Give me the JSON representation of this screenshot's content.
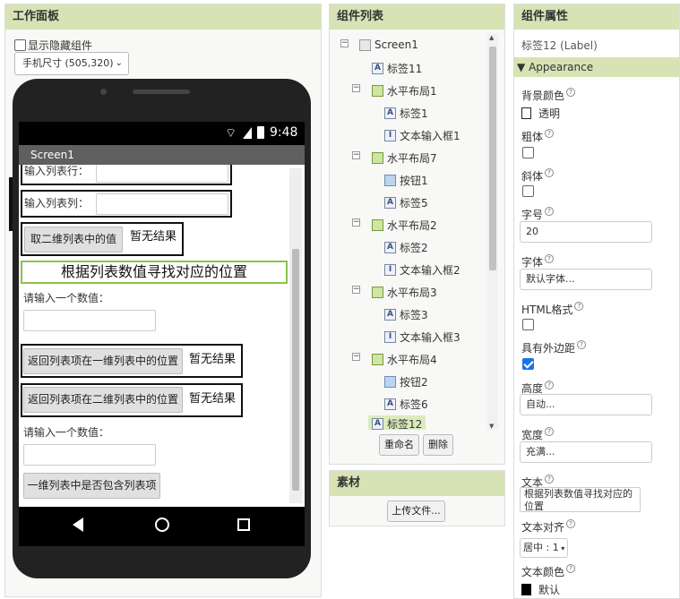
{
  "work": {
    "title": "工作面板",
    "show_hidden": "显示隐藏组件",
    "size_select": "手机尺寸 (505,320)",
    "phone": {
      "time": "9:48",
      "screen_title": "Screen1",
      "row_label": "输入列表行：",
      "col_label": "输入列表列：",
      "get2d_button": "取二维列表中的值",
      "result1": "暂无结果",
      "heading": "根据列表数值寻找对应的位置",
      "prompt1": "请输入一个数值：",
      "btn_1d": "返回列表项在一维列表中的位置",
      "result2": "暂无结果",
      "btn_2d": "返回列表项在二维列表中的位置",
      "result3": "暂无结果",
      "prompt2": "请输入一个数值：",
      "btn_contains": "一维列表中是否包含列表项"
    }
  },
  "tree": {
    "title": "组件列表",
    "nodes": [
      {
        "label": "Screen1",
        "icon": "screen-icon"
      },
      {
        "label": "标签11",
        "icon": "label-icon"
      },
      {
        "label": "水平布局1",
        "icon": "horizontal-layout-icon"
      },
      {
        "label": "标签1",
        "icon": "label-icon"
      },
      {
        "label": "文本输入框1",
        "icon": "textbox-icon"
      },
      {
        "label": "水平布局7",
        "icon": "horizontal-layout-icon"
      },
      {
        "label": "按钮1",
        "icon": "button-icon"
      },
      {
        "label": "标签5",
        "icon": "label-icon"
      },
      {
        "label": "水平布局2",
        "icon": "horizontal-layout-icon"
      },
      {
        "label": "标签2",
        "icon": "label-icon"
      },
      {
        "label": "文本输入框2",
        "icon": "textbox-icon"
      },
      {
        "label": "水平布局3",
        "icon": "horizontal-layout-icon"
      },
      {
        "label": "标签3",
        "icon": "label-icon"
      },
      {
        "label": "文本输入框3",
        "icon": "textbox-icon"
      },
      {
        "label": "水平布局4",
        "icon": "horizontal-layout-icon"
      },
      {
        "label": "按钮2",
        "icon": "button-icon"
      },
      {
        "label": "标签6",
        "icon": "label-icon"
      },
      {
        "label": "标签12",
        "icon": "label-icon"
      }
    ],
    "rename": "重命名",
    "delete": "删除"
  },
  "media": {
    "title": "素材",
    "upload": "上传文件..."
  },
  "props": {
    "title": "组件属性",
    "component": "标签12 (Label)",
    "section": "Appearance",
    "bg_label": "背景颜色",
    "bg_value": "透明",
    "bold_label": "粗体",
    "italic_label": "斜体",
    "fontsize_label": "字号",
    "fontsize_value": "20",
    "font_label": "字体",
    "font_value": "默认字体...",
    "html_label": "HTML格式",
    "margin_label": "具有外边距",
    "height_label": "高度",
    "height_value": "自动...",
    "width_label": "宽度",
    "width_value": "充满...",
    "text_label": "文本",
    "text_value": "根据列表数值寻找对应的位置",
    "align_label": "文本对齐",
    "align_value": "居中 : 1",
    "color_label": "文本颜色",
    "color_value": "默认",
    "q": "?"
  },
  "colors": {
    "header": "#d7e3b5",
    "accent": "#8bc34a"
  }
}
